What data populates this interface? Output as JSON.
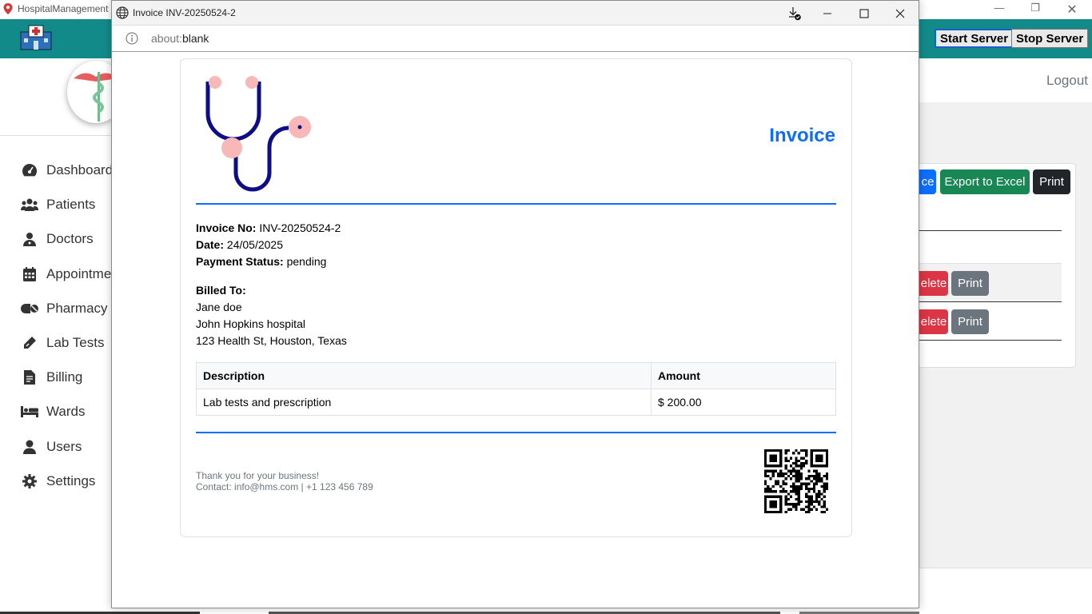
{
  "bg_app": {
    "title": "HospitalManagement",
    "start_server": "Start Server",
    "stop_server": "Stop Server",
    "logout": "Logout",
    "sidebar": {
      "items": [
        {
          "label": "Dashboard",
          "icon": "gauge-icon"
        },
        {
          "label": "Patients",
          "icon": "users-icon"
        },
        {
          "label": "Doctors",
          "icon": "user-doctor-icon"
        },
        {
          "label": "Appointmen",
          "icon": "calendar-icon"
        },
        {
          "label": "Pharmacy",
          "icon": "pills-icon"
        },
        {
          "label": "Lab Tests",
          "icon": "syringe-icon"
        },
        {
          "label": "Billing",
          "icon": "receipt-icon"
        },
        {
          "label": "Wards",
          "icon": "bed-icon"
        },
        {
          "label": "Users",
          "icon": "user-icon"
        },
        {
          "label": "Settings",
          "icon": "gear-icon"
        }
      ]
    },
    "toolbar": {
      "invoice_fragment": "ce",
      "export_excel": "Export to Excel",
      "print": "Print"
    },
    "rows": [
      {
        "delete_fragment": "elete",
        "print": "Print"
      },
      {
        "delete_fragment": "elete",
        "print": "Print"
      }
    ],
    "colors": {
      "header": "#138a8a",
      "primary": "#0d6efd",
      "success": "#198754",
      "danger": "#dc3545",
      "secondary": "#6c757d",
      "dark": "#212529"
    }
  },
  "popup": {
    "window_title": "Invoice INV-20250524-2",
    "url_scheme": "about:",
    "url_rest": "blank",
    "invoice": {
      "heading": "Invoice",
      "invoice_no_label": "Invoice No:",
      "invoice_no": "INV-20250524-2",
      "date_label": "Date:",
      "date": "24/05/2025",
      "payment_status_label": "Payment Status:",
      "payment_status": "pending",
      "billed_to_label": "Billed To:",
      "billed_to": [
        "Jane doe",
        "John Hopkins hospital",
        "123 Health St, Houston, Texas"
      ],
      "table": {
        "headers": [
          "Description",
          "Amount"
        ],
        "rows": [
          [
            "Lab tests and prescription",
            "$ 200.00"
          ]
        ]
      },
      "footer_thanks": "Thank you for your business!",
      "footer_contact": "Contact: info@hms.com | +1 123 456 789"
    }
  }
}
